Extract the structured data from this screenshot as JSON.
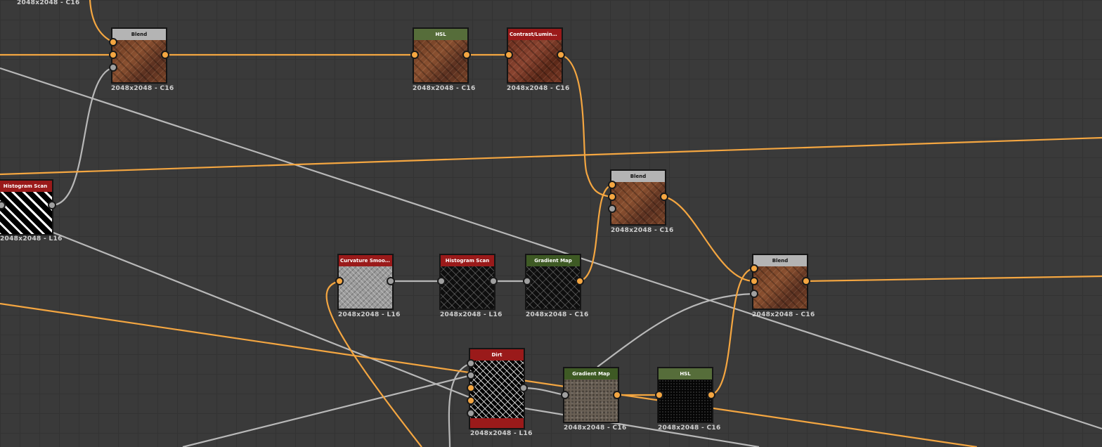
{
  "colors": {
    "color_wire": "#f4a641",
    "gray_wire": "#b8b8b8",
    "background": "#3a3a3a"
  },
  "nodes": [
    {
      "id": "blend1",
      "title": "Blend",
      "format": "2048x2048 - C16"
    },
    {
      "id": "hsl1",
      "title": "HSL",
      "format": "2048x2048 - C16"
    },
    {
      "id": "contrast1",
      "title": "Contrast/Luminosity C...",
      "format": "2048x2048 - C16"
    },
    {
      "id": "histscan1",
      "title": "Histogram Scan",
      "format": "2048x2048 - L16"
    },
    {
      "id": "blend2",
      "title": "Blend",
      "format": "2048x2048 - C16"
    },
    {
      "id": "curvsmooth",
      "title": "Curvature Smooth",
      "format": "2048x2048 - L16"
    },
    {
      "id": "histscan2",
      "title": "Histogram Scan",
      "format": "2048x2048 - L16"
    },
    {
      "id": "gradmap1",
      "title": "Gradient Map",
      "format": "2048x2048 - C16"
    },
    {
      "id": "blend3",
      "title": "Blend",
      "format": "2048x2048 - C16"
    },
    {
      "id": "dirt",
      "title": "Dirt",
      "format": "2048x2048 - L16"
    },
    {
      "id": "gradmap2",
      "title": "Gradient Map",
      "format": "2048x2048 - C16"
    },
    {
      "id": "hsl2",
      "title": "HSL",
      "format": "2048x2048 - C16"
    }
  ],
  "offscreen_label": "2048x2048 - C16"
}
